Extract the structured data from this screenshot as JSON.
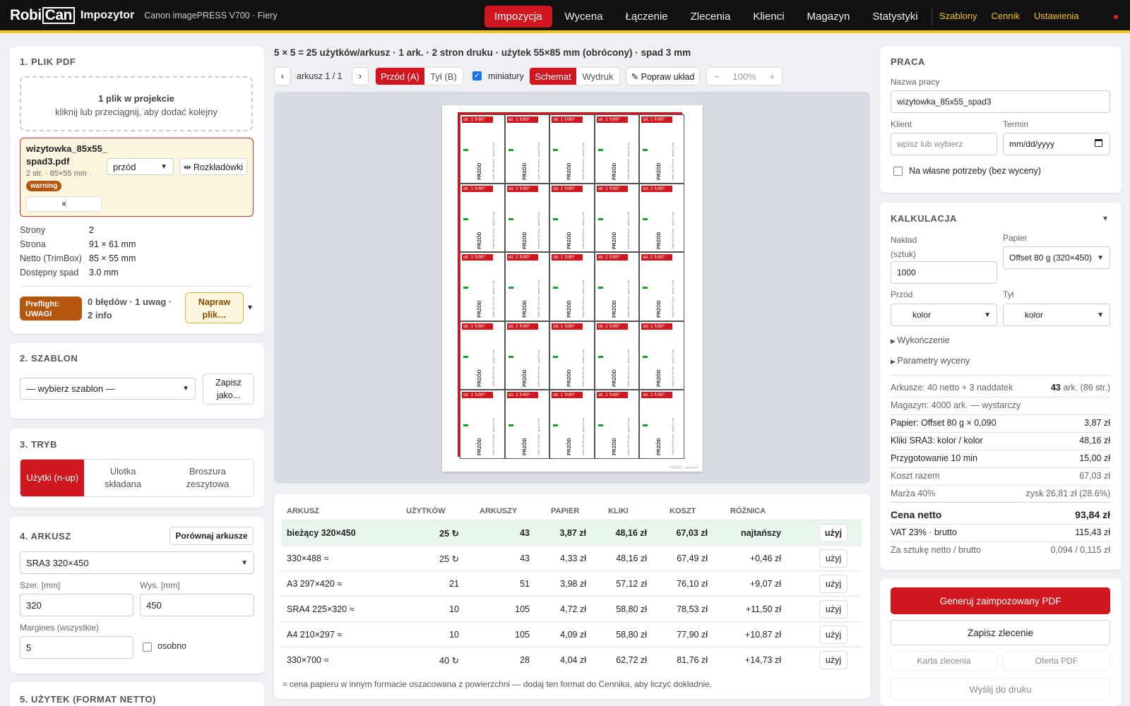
{
  "app": {
    "logo_robi": "Robi",
    "logo_can": "Can",
    "name": "Impozytor",
    "machine": "Canon imagePRESS V700 · Fiery"
  },
  "nav": {
    "items": [
      "Impozycja",
      "Wycena",
      "Łączenie",
      "Zlecenia",
      "Klienci",
      "Magazyn",
      "Statystyki"
    ],
    "right": [
      "Szablony",
      "Cennik",
      "Ustawienia"
    ]
  },
  "left": {
    "s1": {
      "title": "1. PLIK PDF",
      "drop_title": "1 plik w projekcie",
      "drop_sub": "kliknij lub przeciągnij, aby dodać kolejny",
      "file_name": "wizytowka_85x55_spad3.pdf",
      "file_meta": "2 str. · 85×55 mm ·",
      "badge": "warning",
      "side_select": "przód",
      "spread_btn": "⇹ Rozkładówki",
      "remove": "×",
      "props": [
        {
          "k": "Strony",
          "v": "2"
        },
        {
          "k": "Strona",
          "v": "91 × 61 mm"
        },
        {
          "k": "Netto (TrimBox)",
          "v": "85 × 55 mm"
        },
        {
          "k": "Dostępny spad",
          "v": "3.0 mm"
        }
      ],
      "preflight_badge": "Preflight: UWAGI",
      "preflight_text": "0 błędów · 1 uwag · 2 info",
      "fix_btn": "Napraw plik…",
      "chev": "▾"
    },
    "s2": {
      "title": "2. SZABLON",
      "select": "— wybierz szablon —",
      "save_btn": "Zapisz jako..."
    },
    "s3": {
      "title": "3. TRYB",
      "modes": [
        "Użytki (n-up)",
        "Ulotka składana",
        "Broszura zeszytowa"
      ]
    },
    "s4": {
      "title": "4. ARKUSZ",
      "compare_btn": "Porównaj arkusze",
      "sheet_select": "SRA3 320×450",
      "w_label": "Szer. [mm]",
      "w": "320",
      "h_label": "Wys. [mm]",
      "h": "450",
      "margin_label": "Margines (wszystkie)",
      "margin": "5",
      "separate": "osobno"
    },
    "s5": {
      "title": "5. UŻYTEK (FORMAT NETTO)"
    }
  },
  "center": {
    "summary": "5 × 5 = 25 użytków/arkusz · 1 ark. · 2 stron druku · użytek 55×85 mm (obrócony) · spad 3 mm",
    "pager": "arkusz 1 / 1",
    "prev": "‹",
    "next": "›",
    "front": "Przód (A)",
    "back": "Tył (B)",
    "thumbs": "miniatury",
    "schemat": "Schemat",
    "wydruk": "Wydruk",
    "fix_layout": "✎ Popraw układ",
    "zoom_minus": "−",
    "zoom": "100%",
    "zoom_plus": "+",
    "cell_tag": "str. 1 ↻90°",
    "cell_side": "PRZÓD",
    "cell_note": "Netto 85×55 mm · spad 3 mm",
    "sheet_footer": "PRZÓD · arkusz 1",
    "table": {
      "headers": [
        "ARKUSZ",
        "UŻYTKÓW",
        "ARKUSZY",
        "PAPIER",
        "KLIKI",
        "KOSZT",
        "RÓŻNICA"
      ],
      "rows": [
        {
          "arkusz": "bieżący 320×450",
          "uzytkow": "25 ↻",
          "arkuszy": "43",
          "papier": "3,87 zł",
          "kliki": "48,16 zł",
          "koszt": "67,03 zł",
          "roznica": "najtańszy",
          "btn": "użyj"
        },
        {
          "arkusz": "330×488 ≈",
          "uzytkow": "25 ↻",
          "arkuszy": "43",
          "papier": "4,33 zł",
          "kliki": "48,16 zł",
          "koszt": "67,49 zł",
          "roznica": "+0,46 zł",
          "btn": "użyj"
        },
        {
          "arkusz": "A3 297×420 ≈",
          "uzytkow": "21",
          "arkuszy": "51",
          "papier": "3,98 zł",
          "kliki": "57,12 zł",
          "koszt": "76,10 zł",
          "roznica": "+9,07 zł",
          "btn": "użyj"
        },
        {
          "arkusz": "SRA4 225×320 ≈",
          "uzytkow": "10",
          "arkuszy": "105",
          "papier": "4,72 zł",
          "kliki": "58,80 zł",
          "koszt": "78,53 zł",
          "roznica": "+11,50 zł",
          "btn": "użyj"
        },
        {
          "arkusz": "A4 210×297 ≈",
          "uzytkow": "10",
          "arkuszy": "105",
          "papier": "4,09 zł",
          "kliki": "58,80 zł",
          "koszt": "77,90 zł",
          "roznica": "+10,87 zł",
          "btn": "użyj"
        },
        {
          "arkusz": "330×700 ≈",
          "uzytkow": "40 ↻",
          "arkuszy": "28",
          "papier": "4,04 zł",
          "kliki": "62,72 zł",
          "koszt": "81,76 zł",
          "roznica": "+14,73 zł",
          "btn": "użyj"
        }
      ],
      "note": "≈ cena papieru w innym formacie oszacowana z powierzchni — dodaj ten format do Cennika, aby liczyć dokładnie."
    }
  },
  "right": {
    "praca": {
      "title": "PRACA",
      "name_label": "Nazwa pracy",
      "name": "wizytowka_85x55_spad3",
      "client_label": "Klient",
      "client_ph": "wpisz lub wybierz",
      "term_label": "Termin",
      "term": "mm/dd/yyyy",
      "own": "Na własne potrzeby (bez wyceny)"
    },
    "calc": {
      "title": "KALKULACJA",
      "chev": "▾",
      "qty_label": "Nakład (sztuk)",
      "qty": "1000",
      "paper_label": "Papier",
      "paper": "Offset 80 g (320×450)",
      "front_label": "Przód",
      "front": "kolor",
      "back_label": "Tył",
      "back": "kolor",
      "finish": "Wykończenie",
      "params": "Parametry wyceny",
      "sheets_k": "Arkusze: 40 netto + 3 naddatek",
      "sheets_v1": "43",
      "sheets_v2": " ark. (86 str.)",
      "stock": "Magazyn: 4000 ark. — wystarczy",
      "lines": [
        {
          "k": "Papier: Offset 80 g × 0,090",
          "v": "3,87 zł"
        },
        {
          "k": "Kliki SRA3: kolor / kolor",
          "v": "48,16 zł"
        },
        {
          "k": "Przygotowanie 10 min",
          "v": "15,00 zł"
        },
        {
          "k": "Koszt razem",
          "v": "67,03 zł"
        },
        {
          "k": "Marża 40%",
          "v": "zysk 26,81 zł (28.6%)"
        }
      ],
      "net_k": "Cena netto",
      "net_v": "93,84 zł",
      "vat_k": "VAT 23% · brutto",
      "vat_v": "115,43 zł",
      "unit_k": "Za sztukę netto / brutto",
      "unit_v": "0,094 / 0,115 zł"
    },
    "actions": {
      "generate": "Generuj zaimpozowany PDF",
      "save": "Zapisz zlecenie",
      "card": "Karta zlecenia",
      "offer": "Oferta PDF",
      "send": "Wyślij do druku"
    }
  }
}
